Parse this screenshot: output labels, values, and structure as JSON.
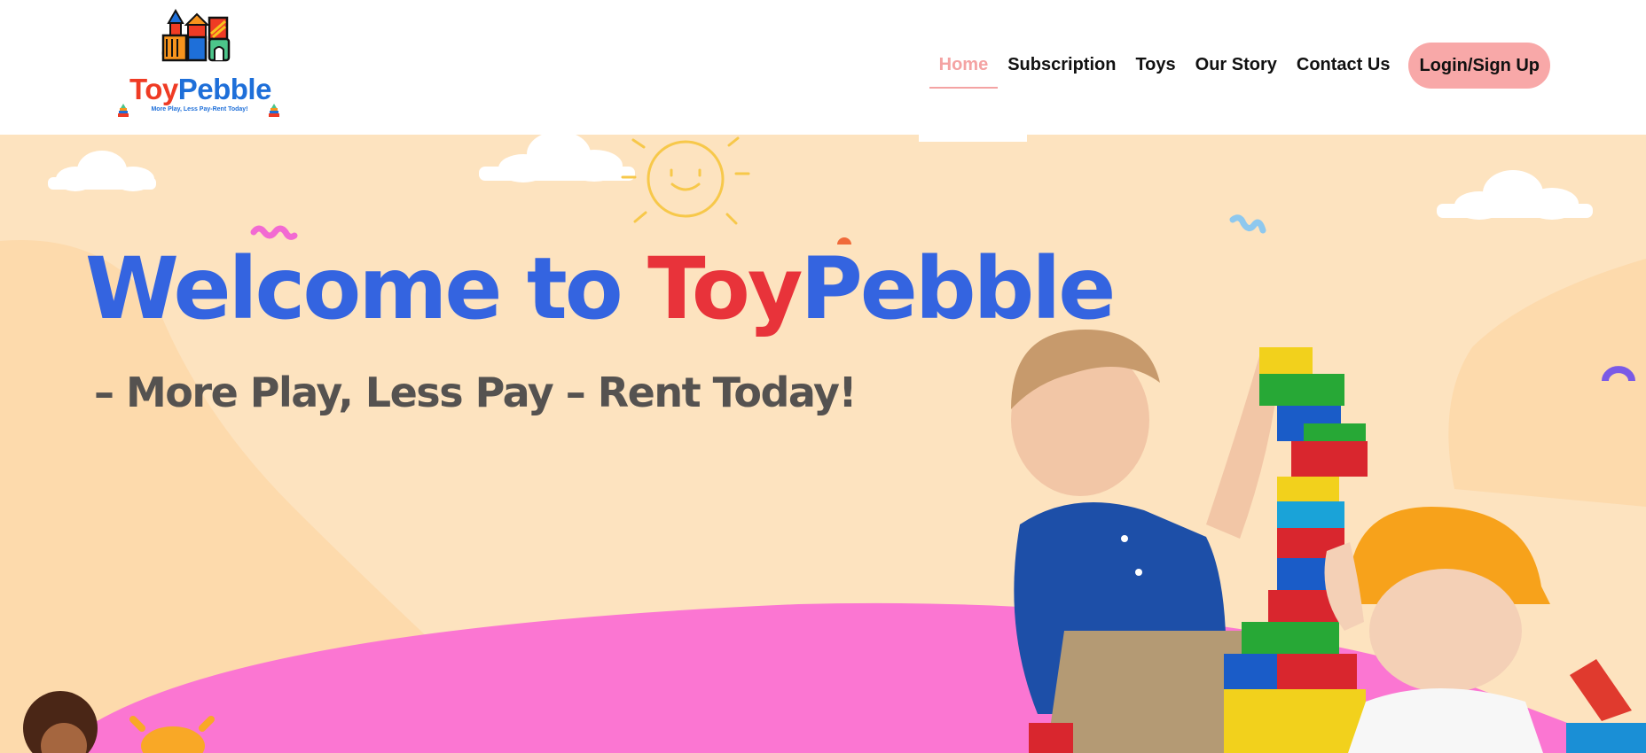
{
  "brand": {
    "name_part1": "Toy",
    "name_part2": "Pebble",
    "tagline": "More Play, Less Pay-Rent Today!"
  },
  "nav": {
    "items": [
      {
        "label": "Home",
        "active": true
      },
      {
        "label": "Subscription",
        "active": false
      },
      {
        "label": "Toys",
        "active": false
      },
      {
        "label": "Our Story",
        "active": false
      },
      {
        "label": "Contact Us",
        "active": false
      }
    ],
    "login_label": "Login/Sign Up"
  },
  "hero": {
    "title_part1": "Welcome to ",
    "title_part2": "Toy",
    "title_part3": "Pebble",
    "subtitle": "– More Play, Less Pay – Rent Today!"
  },
  "colors": {
    "nav_active": "#f4a3a3",
    "login_bg": "#f8a8a8",
    "hero_bg": "#fde3bf",
    "title_blue": "#3464e0",
    "title_red": "#e8333a",
    "ground_pink": "#fb76d2"
  },
  "icons": [
    "toy-blocks-logo-icon",
    "cloud-icon",
    "sun-icon",
    "squiggle-icon",
    "toy-pyramid-icon"
  ]
}
